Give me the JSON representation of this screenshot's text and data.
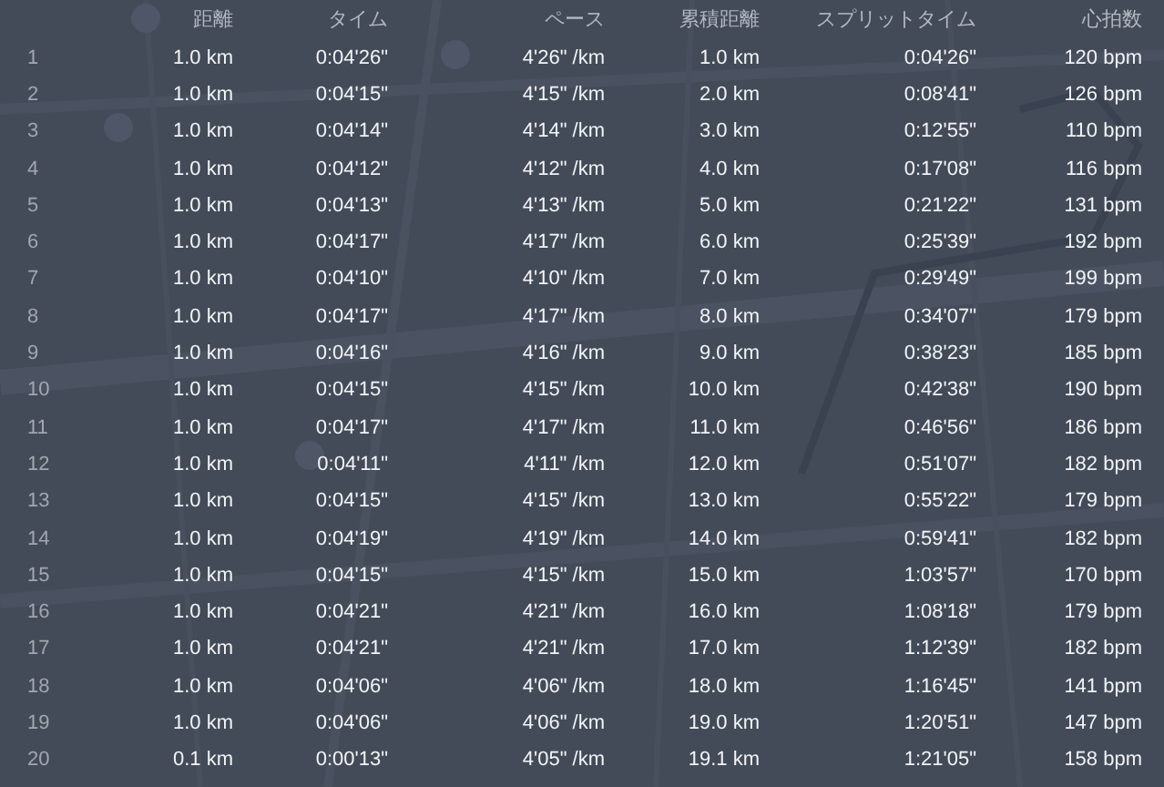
{
  "table": {
    "columns": [
      "距離",
      "タイム",
      "ペース",
      "累積距離",
      "スプリットタイム",
      "心拍数"
    ],
    "rows": [
      {
        "lap": "1",
        "distance": "1.0 km",
        "time": "0:04'26\"",
        "pace": "4'26\" /km",
        "cumulative": "1.0 km",
        "split": "0:04'26\"",
        "heart_rate": "120 bpm"
      },
      {
        "lap": "2",
        "distance": "1.0 km",
        "time": "0:04'15\"",
        "pace": "4'15\" /km",
        "cumulative": "2.0 km",
        "split": "0:08'41\"",
        "heart_rate": "126 bpm"
      },
      {
        "lap": "3",
        "distance": "1.0 km",
        "time": "0:04'14\"",
        "pace": "4'14\" /km",
        "cumulative": "3.0 km",
        "split": "0:12'55\"",
        "heart_rate": "110 bpm"
      },
      {
        "lap": "4",
        "distance": "1.0 km",
        "time": "0:04'12\"",
        "pace": "4'12\" /km",
        "cumulative": "4.0 km",
        "split": "0:17'08\"",
        "heart_rate": "116 bpm"
      },
      {
        "lap": "5",
        "distance": "1.0 km",
        "time": "0:04'13\"",
        "pace": "4'13\" /km",
        "cumulative": "5.0 km",
        "split": "0:21'22\"",
        "heart_rate": "131 bpm"
      },
      {
        "lap": "6",
        "distance": "1.0 km",
        "time": "0:04'17\"",
        "pace": "4'17\" /km",
        "cumulative": "6.0 km",
        "split": "0:25'39\"",
        "heart_rate": "192 bpm"
      },
      {
        "lap": "7",
        "distance": "1.0 km",
        "time": "0:04'10\"",
        "pace": "4'10\" /km",
        "cumulative": "7.0 km",
        "split": "0:29'49\"",
        "heart_rate": "199 bpm"
      },
      {
        "lap": "8",
        "distance": "1.0 km",
        "time": "0:04'17\"",
        "pace": "4'17\" /km",
        "cumulative": "8.0 km",
        "split": "0:34'07\"",
        "heart_rate": "179 bpm"
      },
      {
        "lap": "9",
        "distance": "1.0 km",
        "time": "0:04'16\"",
        "pace": "4'16\" /km",
        "cumulative": "9.0 km",
        "split": "0:38'23\"",
        "heart_rate": "185 bpm"
      },
      {
        "lap": "10",
        "distance": "1.0 km",
        "time": "0:04'15\"",
        "pace": "4'15\" /km",
        "cumulative": "10.0 km",
        "split": "0:42'38\"",
        "heart_rate": "190 bpm"
      },
      {
        "lap": "11",
        "distance": "1.0 km",
        "time": "0:04'17\"",
        "pace": "4'17\" /km",
        "cumulative": "11.0 km",
        "split": "0:46'56\"",
        "heart_rate": "186 bpm"
      },
      {
        "lap": "12",
        "distance": "1.0 km",
        "time": "0:04'11\"",
        "pace": "4'11\" /km",
        "cumulative": "12.0 km",
        "split": "0:51'07\"",
        "heart_rate": "182 bpm"
      },
      {
        "lap": "13",
        "distance": "1.0 km",
        "time": "0:04'15\"",
        "pace": "4'15\" /km",
        "cumulative": "13.0 km",
        "split": "0:55'22\"",
        "heart_rate": "179 bpm"
      },
      {
        "lap": "14",
        "distance": "1.0 km",
        "time": "0:04'19\"",
        "pace": "4'19\" /km",
        "cumulative": "14.0 km",
        "split": "0:59'41\"",
        "heart_rate": "182 bpm"
      },
      {
        "lap": "15",
        "distance": "1.0 km",
        "time": "0:04'15\"",
        "pace": "4'15\" /km",
        "cumulative": "15.0 km",
        "split": "1:03'57\"",
        "heart_rate": "170 bpm"
      },
      {
        "lap": "16",
        "distance": "1.0 km",
        "time": "0:04'21\"",
        "pace": "4'21\" /km",
        "cumulative": "16.0 km",
        "split": "1:08'18\"",
        "heart_rate": "179 bpm"
      },
      {
        "lap": "17",
        "distance": "1.0 km",
        "time": "0:04'21\"",
        "pace": "4'21\" /km",
        "cumulative": "17.0 km",
        "split": "1:12'39\"",
        "heart_rate": "182 bpm"
      },
      {
        "lap": "18",
        "distance": "1.0 km",
        "time": "0:04'06\"",
        "pace": "4'06\" /km",
        "cumulative": "18.0 km",
        "split": "1:16'45\"",
        "heart_rate": "141 bpm"
      },
      {
        "lap": "19",
        "distance": "1.0 km",
        "time": "0:04'06\"",
        "pace": "4'06\" /km",
        "cumulative": "19.0 km",
        "split": "1:20'51\"",
        "heart_rate": "147 bpm"
      },
      {
        "lap": "20",
        "distance": "0.1 km",
        "time": "0:00'13\"",
        "pace": "4'05\" /km",
        "cumulative": "19.1 km",
        "split": "1:21'05\"",
        "heart_rate": "158 bpm"
      }
    ]
  }
}
